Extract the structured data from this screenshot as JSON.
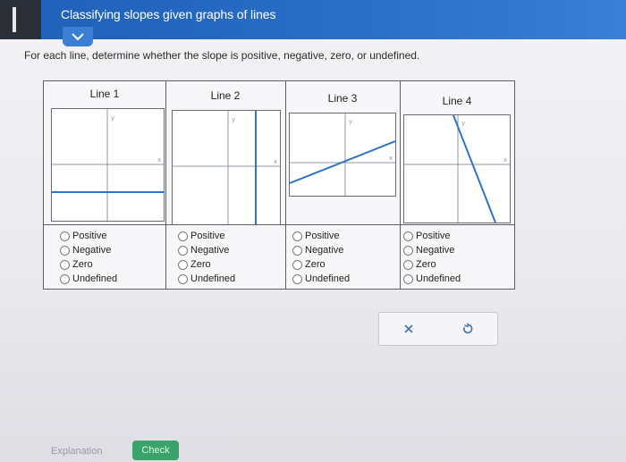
{
  "header": {
    "title": "Classifying slopes given graphs of lines"
  },
  "instructions": "For each line, determine whether the slope is positive, negative, zero, or undefined.",
  "columns": [
    {
      "title": "Line 1",
      "options": [
        "Positive",
        "Negative",
        "Zero",
        "Undefined"
      ]
    },
    {
      "title": "Line 2",
      "options": [
        "Positive",
        "Negative",
        "Zero",
        "Undefined"
      ]
    },
    {
      "title": "Line 3",
      "options": [
        "Positive",
        "Negative",
        "Zero",
        "Undefined"
      ]
    },
    {
      "title": "Line 4",
      "options": [
        "Positive",
        "Negative",
        "Zero",
        "Undefined"
      ]
    }
  ],
  "axis_labels": {
    "x": "x",
    "y": "y"
  },
  "actions": {
    "clear_icon": "close-icon",
    "reset_icon": "undo-icon"
  },
  "footer": {
    "explanation": "Explanation",
    "check": "Check"
  },
  "colors": {
    "header": "#2a6fc8",
    "line": "#2f74c4",
    "check": "#3aa26a"
  }
}
